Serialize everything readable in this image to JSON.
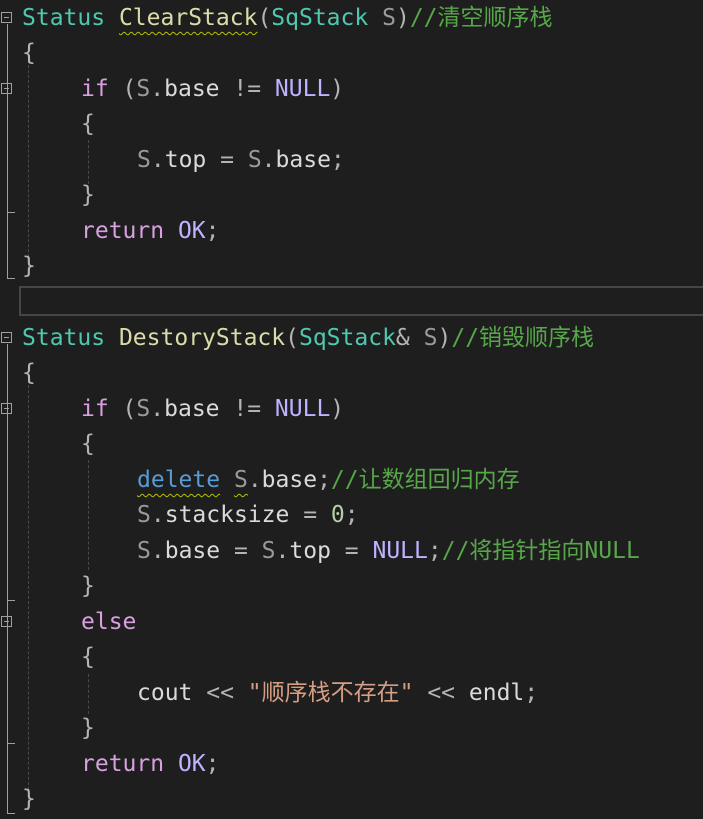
{
  "editor": {
    "lines": [
      {
        "tokens": [
          {
            "t": "Status",
            "c": "ty"
          },
          {
            "t": " ",
            "c": "pun"
          },
          {
            "t": "ClearStack",
            "c": "fn",
            "squig": true
          },
          {
            "t": "(",
            "c": "pun"
          },
          {
            "t": "SqStack",
            "c": "ty"
          },
          {
            "t": " ",
            "c": "pun"
          },
          {
            "t": "S",
            "c": "var"
          },
          {
            "t": ")",
            "c": "pun"
          },
          {
            "t": "//清空顺序栈",
            "c": "cm"
          }
        ]
      },
      {
        "tokens": [
          {
            "t": "{",
            "c": "pun"
          }
        ]
      },
      {
        "tokens": [
          {
            "t": "if",
            "c": "ctl"
          },
          {
            "t": " (",
            "c": "pun"
          },
          {
            "t": "S",
            "c": "var"
          },
          {
            "t": ".",
            "c": "pun"
          },
          {
            "t": "base",
            "c": "mem"
          },
          {
            "t": " != ",
            "c": "pun"
          },
          {
            "t": "NULL",
            "c": "mac"
          },
          {
            "t": ")",
            "c": "pun"
          }
        ]
      },
      {
        "tokens": [
          {
            "t": "{",
            "c": "pun"
          }
        ]
      },
      {
        "tokens": [
          {
            "t": "S",
            "c": "var"
          },
          {
            "t": ".",
            "c": "pun"
          },
          {
            "t": "top",
            "c": "mem"
          },
          {
            "t": " = ",
            "c": "pun"
          },
          {
            "t": "S",
            "c": "var"
          },
          {
            "t": ".",
            "c": "pun"
          },
          {
            "t": "base",
            "c": "mem"
          },
          {
            "t": ";",
            "c": "pun"
          }
        ]
      },
      {
        "tokens": [
          {
            "t": "}",
            "c": "pun"
          }
        ]
      },
      {
        "tokens": [
          {
            "t": "return",
            "c": "ctl"
          },
          {
            "t": " ",
            "c": "pun"
          },
          {
            "t": "OK",
            "c": "mac"
          },
          {
            "t": ";",
            "c": "pun"
          }
        ]
      },
      {
        "tokens": [
          {
            "t": "}",
            "c": "pun"
          }
        ]
      },
      {
        "tokens": []
      },
      {
        "tokens": [
          {
            "t": "Status",
            "c": "ty"
          },
          {
            "t": " ",
            "c": "pun"
          },
          {
            "t": "DestoryStack",
            "c": "fn"
          },
          {
            "t": "(",
            "c": "pun"
          },
          {
            "t": "SqStack",
            "c": "ty"
          },
          {
            "t": "& ",
            "c": "pun"
          },
          {
            "t": "S",
            "c": "var"
          },
          {
            "t": ")",
            "c": "pun"
          },
          {
            "t": "//销毁顺序栈",
            "c": "cm"
          }
        ]
      },
      {
        "tokens": [
          {
            "t": "{",
            "c": "pun"
          }
        ]
      },
      {
        "tokens": [
          {
            "t": "if",
            "c": "ctl"
          },
          {
            "t": " (",
            "c": "pun"
          },
          {
            "t": "S",
            "c": "var"
          },
          {
            "t": ".",
            "c": "pun"
          },
          {
            "t": "base",
            "c": "mem"
          },
          {
            "t": " != ",
            "c": "pun"
          },
          {
            "t": "NULL",
            "c": "mac"
          },
          {
            "t": ")",
            "c": "pun"
          }
        ]
      },
      {
        "tokens": [
          {
            "t": "{",
            "c": "pun"
          }
        ]
      },
      {
        "tokens": [
          {
            "t": "delete",
            "c": "kw",
            "squig": true
          },
          {
            "t": " ",
            "c": "pun"
          },
          {
            "t": "S",
            "c": "var",
            "squig": true
          },
          {
            "t": ".",
            "c": "pun"
          },
          {
            "t": "base",
            "c": "mem"
          },
          {
            "t": ";",
            "c": "pun"
          },
          {
            "t": "//让数组回归内存",
            "c": "cm"
          }
        ]
      },
      {
        "tokens": [
          {
            "t": "S",
            "c": "var"
          },
          {
            "t": ".",
            "c": "pun"
          },
          {
            "t": "stacksize",
            "c": "mem"
          },
          {
            "t": " = ",
            "c": "pun"
          },
          {
            "t": "0",
            "c": "num"
          },
          {
            "t": ";",
            "c": "pun"
          }
        ]
      },
      {
        "tokens": [
          {
            "t": "S",
            "c": "var"
          },
          {
            "t": ".",
            "c": "pun"
          },
          {
            "t": "base",
            "c": "mem"
          },
          {
            "t": " = ",
            "c": "pun"
          },
          {
            "t": "S",
            "c": "var"
          },
          {
            "t": ".",
            "c": "pun"
          },
          {
            "t": "top",
            "c": "mem"
          },
          {
            "t": " = ",
            "c": "pun"
          },
          {
            "t": "NULL",
            "c": "mac"
          },
          {
            "t": ";",
            "c": "pun"
          },
          {
            "t": "//将指针指向NULL",
            "c": "cm"
          }
        ]
      },
      {
        "tokens": [
          {
            "t": "}",
            "c": "pun"
          }
        ]
      },
      {
        "tokens": [
          {
            "t": "else",
            "c": "ctl"
          }
        ]
      },
      {
        "tokens": [
          {
            "t": "{",
            "c": "pun"
          }
        ]
      },
      {
        "tokens": [
          {
            "t": "cout",
            "c": "mem"
          },
          {
            "t": " << ",
            "c": "pun"
          },
          {
            "t": "\"顺序栈不存在\"",
            "c": "str"
          },
          {
            "t": " << ",
            "c": "pun"
          },
          {
            "t": "endl",
            "c": "mem"
          },
          {
            "t": ";",
            "c": "pun"
          }
        ]
      },
      {
        "tokens": [
          {
            "t": "}",
            "c": "pun"
          }
        ]
      },
      {
        "tokens": [
          {
            "t": "return",
            "c": "ctl"
          },
          {
            "t": " ",
            "c": "pun"
          },
          {
            "t": "OK",
            "c": "mac"
          },
          {
            "t": ";",
            "c": "pun"
          }
        ]
      },
      {
        "tokens": [
          {
            "t": "}",
            "c": "pun"
          }
        ]
      }
    ]
  }
}
